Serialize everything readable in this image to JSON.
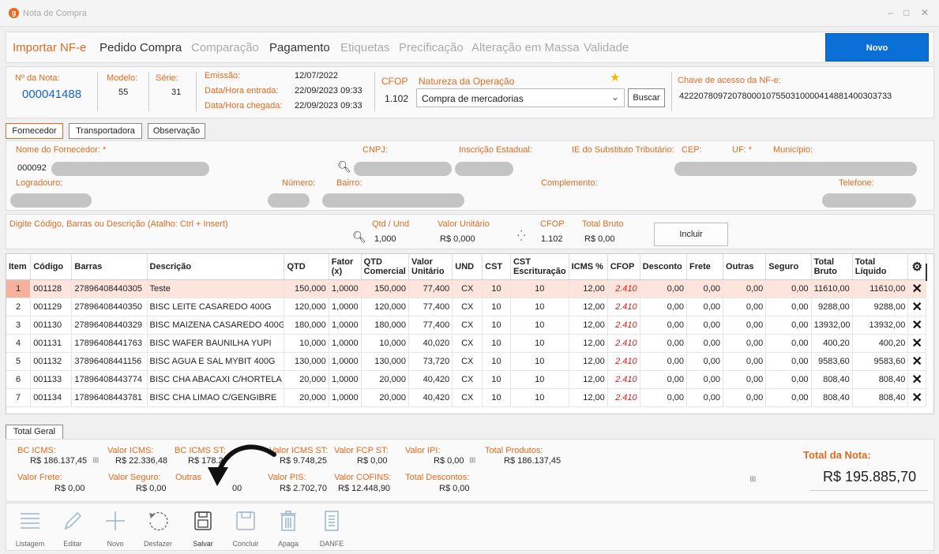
{
  "window": {
    "title": "Nota de Compra",
    "logo": "g",
    "minimize": "–",
    "maximize": "□",
    "close": "✕"
  },
  "menu": {
    "items": [
      {
        "label": "Importar NF-e",
        "state": "active-orange"
      },
      {
        "label": "Pedido Compra",
        "state": "enabled"
      },
      {
        "label": "Comparação",
        "state": "disabled"
      },
      {
        "label": "Pagamento",
        "state": "enabled"
      },
      {
        "label": "Etiquetas",
        "state": "disabled"
      },
      {
        "label": "Precificação",
        "state": "disabled"
      },
      {
        "label": "Alteração em Massa",
        "state": "disabled"
      },
      {
        "label": "Validade",
        "state": "disabled"
      }
    ],
    "novo": "Novo"
  },
  "header": {
    "nota_label": "Nº da Nota:",
    "nota_value": "000041488",
    "modelo_label": "Modelo:",
    "modelo_value": "55",
    "serie_label": "Série:",
    "serie_value": "31",
    "emissao_label": "Emissão:",
    "emissao_value": "12/07/2022",
    "entrada_label": "Data/Hora entrada:",
    "entrada_value": "22/09/2023  09:33",
    "chegada_label": "Data/Hora chegada:",
    "chegada_value": "22/09/2023  09:33",
    "cfop_label": "CFOP",
    "cfop_value": "1.102",
    "natureza_label": "Natureza da Operação",
    "natureza_value": "Compra de mercadorias",
    "buscar": "Buscar",
    "chave_label": "Chave de acesso da NF-e:",
    "chave_value": "42220780972078000107550310000414881400303733"
  },
  "tabs": [
    "Fornecedor",
    "Transportadora",
    "Observação"
  ],
  "fornecedor": {
    "nome_label": "Nome do Fornecedor: *",
    "codigo": "000092",
    "cnpj_label": "CNPJ:",
    "ie_label": "Inscrição Estadual:",
    "iest_label": "IE do Substituto Tributário:",
    "cep_label": "CEP:",
    "uf_label": "UF: *",
    "municipio_label": "Município:",
    "logradouro_label": "Logradouro:",
    "numero_label": "Número:",
    "bairro_label": "Bairro:",
    "complemento_label": "Complemento:",
    "telefone_label": "Telefone:"
  },
  "entry": {
    "search_label": "Digite Código, Barras ou Descrição (Atalho: Ctrl + Insert)",
    "qtd_label": "Qtd / Und",
    "qtd_value": "1,000",
    "vunit_label": "Valor Unitário",
    "vunit_value": "R$ 0,000",
    "cfop_label": "CFOP",
    "cfop_value": "1.102",
    "tbruto_label": "Total Bruto",
    "tbruto_value": "R$ 0,00",
    "incluir": "Incluir"
  },
  "grid": {
    "columns": [
      "Item",
      "Código",
      "Barras",
      "Descrição",
      "QTD",
      "Fator (x)",
      "QTD Comercial",
      "Valor Unitário",
      "UND",
      "CST",
      "CST Escrituração",
      "ICMS %",
      "CFOP",
      "Desconto",
      "Frete",
      "Outras",
      "Seguro",
      "Total Bruto",
      "Total Líquido"
    ],
    "rows": [
      [
        "1",
        "001128",
        "27896408440305",
        "Teste",
        "150,000",
        "1,0000",
        "150,000",
        "77,400",
        "CX",
        "10",
        "10",
        "12,00",
        "2.410",
        "0,00",
        "0,00",
        "0,00",
        "0,00",
        "11610,00",
        "11610,00"
      ],
      [
        "2",
        "001129",
        "27896408440350",
        "BISC LEITE CASAREDO 400G",
        "120,000",
        "1,0000",
        "120,000",
        "77,400",
        "CX",
        "10",
        "10",
        "12,00",
        "2.410",
        "0,00",
        "0,00",
        "0,00",
        "0,00",
        "9288,00",
        "9288,00"
      ],
      [
        "3",
        "001130",
        "27896408440329",
        "BISC MAIZENA CASAREDO 400G",
        "180,000",
        "1,0000",
        "180,000",
        "77,400",
        "CX",
        "10",
        "10",
        "12,00",
        "2.410",
        "0,00",
        "0,00",
        "0,00",
        "0,00",
        "13932,00",
        "13932,00"
      ],
      [
        "4",
        "001131",
        "17896408441763",
        "BISC WAFER BAUNILHA YUPI",
        "10,000",
        "1,0000",
        "10,000",
        "40,020",
        "CX",
        "10",
        "10",
        "12,00",
        "2.410",
        "0,00",
        "0,00",
        "0,00",
        "0,00",
        "400,20",
        "400,20"
      ],
      [
        "5",
        "001132",
        "37896408441156",
        "BISC AGUA E SAL MYBIT 400G",
        "130,000",
        "1,0000",
        "130,000",
        "73,720",
        "CX",
        "10",
        "10",
        "12,00",
        "2.410",
        "0,00",
        "0,00",
        "0,00",
        "0,00",
        "9583,60",
        "9583,60"
      ],
      [
        "6",
        "001133",
        "17896408443774",
        "BISC CHA ABACAXI C/HORTELA",
        "20,000",
        "1,0000",
        "20,000",
        "40,420",
        "CX",
        "10",
        "10",
        "12,00",
        "2.410",
        "0,00",
        "0,00",
        "0,00",
        "0,00",
        "808,40",
        "808,40"
      ],
      [
        "7",
        "001134",
        "17896408443781",
        "BISC CHA LIMAO C/GENGIBRE",
        "20,000",
        "1,0000",
        "20,000",
        "40,420",
        "CX",
        "10",
        "10",
        "12,00",
        "2.410",
        "0,00",
        "0,00",
        "0,00",
        "0,00",
        "808,40",
        "808,40"
      ]
    ],
    "delete_glyph": "✕"
  },
  "total_geral_tab": "Total Geral",
  "totals": {
    "bc_icms_label": "BC ICMS:",
    "bc_icms": "R$ 186.137,45",
    "vicms_label": "Valor ICMS:",
    "vicms": "R$ 22.336,48",
    "bcst_label": "BC ICMS ST:",
    "bcst": "R$ 178.2",
    "vicmsst_label": "Valor ICMS ST:",
    "vicmsst": "R$ 9.748,25",
    "fcpst_label": "Valor FCP ST:",
    "fcpst": "R$ 0,00",
    "ipi_label": "Valor IPI:",
    "ipi": "R$ 0,00",
    "tprod_label": "Total Produtos:",
    "tprod": "R$ 186.137,45",
    "frete_label": "Valor Frete:",
    "frete": "R$ 0,00",
    "seguro_label": "Valor Seguro:",
    "seguro": "R$ 0,00",
    "outras_label": "Outras",
    "outras": "00",
    "pis_label": "Valor PIS:",
    "pis": "R$ 2.702,70",
    "cofins_label": "Valor COFINS:",
    "cofins": "R$ 12.448,90",
    "tdesc_label": "Total Descontos:",
    "tdesc": "R$ 0,00",
    "total_nota_label": "Total da Nota:",
    "total_nota": "R$ 195.885,70"
  },
  "toolbar": [
    {
      "label": "Listagem",
      "icon": "list-icon"
    },
    {
      "label": "Editar",
      "icon": "pencil-icon"
    },
    {
      "label": "Novo",
      "icon": "plus-icon"
    },
    {
      "label": "Desfazer",
      "icon": "undo-icon"
    },
    {
      "label": "Salvar",
      "icon": "save-icon"
    },
    {
      "label": "Concluir",
      "icon": "save-done-icon"
    },
    {
      "label": "Apaga",
      "icon": "trash-icon"
    },
    {
      "label": "DANFE",
      "icon": "document-icon"
    }
  ],
  "colors": {
    "accent": "#e06b1e",
    "primary": "#0a6fd6",
    "nota_blue": "#1565c0",
    "cfop_red": "#d21e1e",
    "selected_row": "#fde4dc"
  }
}
